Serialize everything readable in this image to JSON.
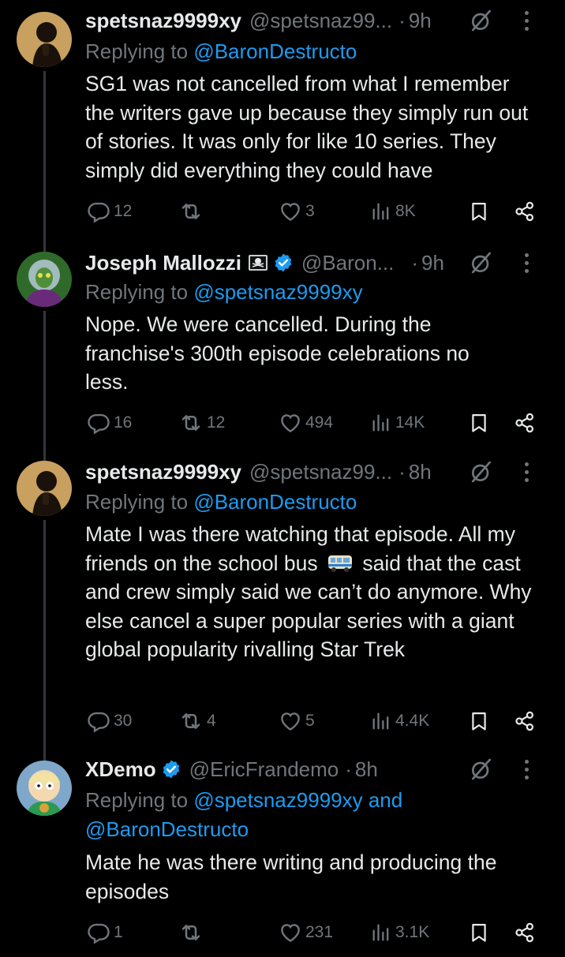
{
  "tweets": [
    {
      "name": "spetsnaz9999xy",
      "handle": "@spetsnaz99...",
      "dot": "·",
      "time": "9h",
      "replying_prefix": "Replying to ",
      "replying_to": "@BaronDestructo",
      "body": "SG1 was not cancelled from what I remember the writers gave up because they simply run out of stories. It was only for like 10 series. They simply did everything they could have",
      "replies": "12",
      "reposts": "",
      "likes": "3",
      "views": "8K"
    },
    {
      "name": "Joseph Mallozzi",
      "handle": "@Baron...",
      "dot": "·",
      "time": "9h",
      "replying_prefix": "Replying to ",
      "replying_to": "@spetsnaz9999xy",
      "body": "Nope.  We were cancelled.  During the franchise's 300th episode celebrations no less.",
      "replies": "16",
      "reposts": "12",
      "likes": "494",
      "views": "14K"
    },
    {
      "name": "spetsnaz9999xy",
      "handle": "@spetsnaz99...",
      "dot": "·",
      "time": "8h",
      "replying_prefix": "Replying to ",
      "replying_to": "@BaronDestructo",
      "body_part1": "Mate I was there watching that episode. All my friends on the school bus",
      "body_part2": "said that the cast and crew simply said we can’t do anymore. Why else cancel a super popular series with a giant global popularity rivalling Star Trek",
      "replies": "30",
      "reposts": "4",
      "likes": "5",
      "views": "4.4K"
    },
    {
      "name": "XDemo",
      "handle": "@EricFrandemo",
      "dot": "·",
      "time": "8h",
      "replying_prefix": "Replying to ",
      "replying_to": "@spetsnaz9999xy",
      "replying_and": " and",
      "replying_to2": "@BaronDestructo",
      "body": "Mate he was there writing and producing the episodes",
      "replies": "1",
      "reposts": "",
      "likes": "231",
      "views": "3.1K"
    }
  ],
  "colors": {
    "accent": "#1d9bf0",
    "muted": "#71767b",
    "text": "#e7e9ea",
    "background": "#000000"
  },
  "icons": [
    "reply-icon",
    "repost-icon",
    "like-icon",
    "views-icon",
    "bookmark-icon",
    "share-icon",
    "grok-icon",
    "more-icon",
    "verified-icon",
    "pirate-flag-icon",
    "bus-emoji-icon"
  ]
}
